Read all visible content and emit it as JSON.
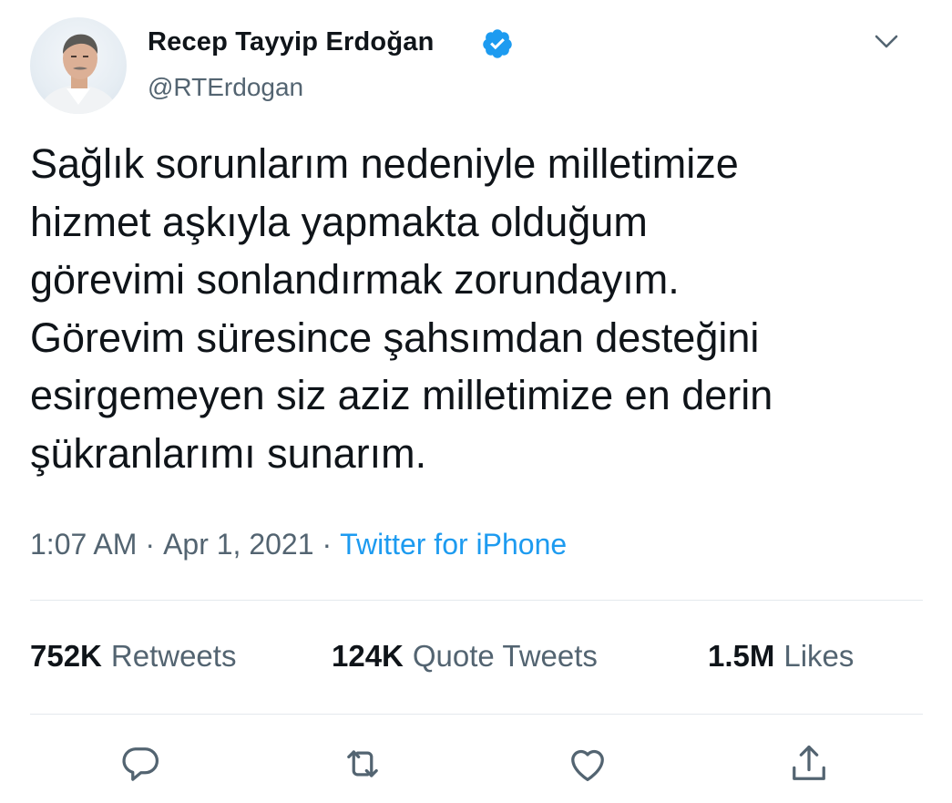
{
  "author": {
    "display_name": "Recep Tayyip Erdoğan",
    "handle": "@RTErdogan",
    "verified": true
  },
  "icons": {
    "verified": "verified-badge-icon",
    "menu": "chevron-down-icon",
    "reply": "reply-icon",
    "retweet": "retweet-icon",
    "like": "heart-icon",
    "share": "share-icon"
  },
  "tweet": {
    "lines": [
      "Sağlık sorunlarım nedeniyle milletimize",
      "hizmet aşkıyla yapmakta olduğum",
      "görevimi sonlandırmak zorundayım.",
      "Görevim süresince şahsımdan desteğini",
      "esirgemeyen siz aziz milletimize en derin",
      "şükranlarımı sunarım."
    ],
    "time": "1:07 AM",
    "separator": "·",
    "date": "Apr 1, 2021",
    "source": "Twitter for iPhone"
  },
  "stats": {
    "retweets_count": "752K",
    "retweets_label": "Retweets",
    "quotes_count": "124K",
    "quotes_label": "Quote Tweets",
    "likes_count": "1.5M",
    "likes_label": "Likes"
  },
  "colors": {
    "accent": "#1d9bf0",
    "secondary_text": "#536471",
    "primary_text": "#0f1419",
    "divider": "#e4e9ed"
  }
}
